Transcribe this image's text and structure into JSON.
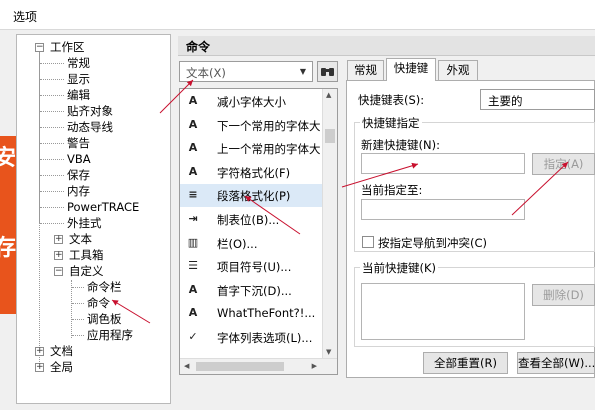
{
  "window": {
    "title": "选项"
  },
  "overlay_glyphs": [
    "安",
    "存"
  ],
  "tree": {
    "items": [
      {
        "label": "工作区",
        "expander": "⊟"
      },
      {
        "label": "常规"
      },
      {
        "label": "显示"
      },
      {
        "label": "编辑"
      },
      {
        "label": "贴齐对象"
      },
      {
        "label": "动态导线"
      },
      {
        "label": "警告"
      },
      {
        "label": "VBA"
      },
      {
        "label": "保存"
      },
      {
        "label": "内存"
      },
      {
        "label": "PowerTRACE"
      },
      {
        "label": "外挂式"
      },
      {
        "label": "文本",
        "expander": "⊞"
      },
      {
        "label": "工具箱",
        "expander": "⊞"
      },
      {
        "label": "自定义",
        "expander": "⊟"
      },
      {
        "label": "命令栏"
      },
      {
        "label": "命令",
        "selected": true
      },
      {
        "label": "调色板"
      },
      {
        "label": "应用程序"
      },
      {
        "label": "文档",
        "expander": "⊞"
      },
      {
        "label": "全局",
        "expander": "⊞"
      }
    ]
  },
  "panel": {
    "title": "命令",
    "category_combo": "文本(X)",
    "find_button_icon": "binoculars-icon",
    "commands": [
      {
        "icon": "shrink-font-icon",
        "glyph": "A",
        "label": "减小字体大小"
      },
      {
        "icon": "next-font-size-icon",
        "glyph": "A",
        "label": "下一个常用的字体大"
      },
      {
        "icon": "prev-font-size-icon",
        "glyph": "A",
        "label": "上一个常用的字体大"
      },
      {
        "icon": "char-format-icon",
        "glyph": "A",
        "label": "字符格式化(F)"
      },
      {
        "icon": "paragraph-format-icon",
        "glyph": "≡",
        "label": "段落格式化(P)",
        "selected": true
      },
      {
        "icon": "tabs-icon",
        "glyph": "⇥",
        "label": "制表位(B)..."
      },
      {
        "icon": "columns-icon",
        "glyph": "▥",
        "label": "栏(O)..."
      },
      {
        "icon": "bullets-icon",
        "glyph": "☰",
        "label": "项目符号(U)..."
      },
      {
        "icon": "drop-cap-icon",
        "glyph": "A",
        "label": "首字下沉(D)..."
      },
      {
        "icon": "whatthefont-icon",
        "glyph": "A",
        "label": "WhatTheFont?!..."
      },
      {
        "icon": "font-list-icon",
        "glyph": "✓",
        "label": "字体列表选项(L)..."
      }
    ]
  },
  "tabs": [
    {
      "label": "常规"
    },
    {
      "label": "快捷键",
      "active": true
    },
    {
      "label": "外观"
    }
  ],
  "shortcuts": {
    "table_label": "快捷键表(S):",
    "table_value": "主要的",
    "assign_group_label": "快捷键指定",
    "new_shortcut_label": "新建快捷键(N):",
    "new_shortcut_value": "",
    "assign_button": "指定(A)",
    "currently_assigned_label": "当前指定至:",
    "currently_assigned_value": "",
    "nav_conflict_label": "按指定导航到冲突(C)",
    "nav_conflict_checked": false,
    "current_shortcuts_label": "当前快捷键(K)",
    "delete_button": "删除(D)",
    "reset_all_button": "全部重置(R)",
    "view_all_button": "查看全部(W)..."
  },
  "annotation_color": "#c8102e"
}
